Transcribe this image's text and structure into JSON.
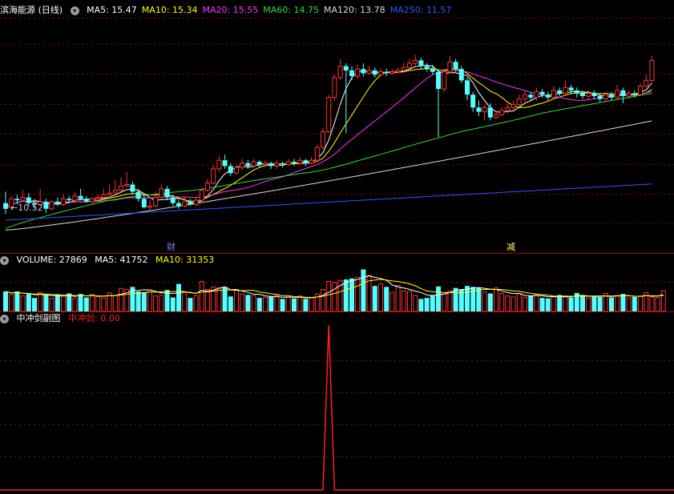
{
  "header": {
    "title": "滨海能源 (日线)",
    "ma_items": [
      {
        "label": "MA5: 15.47",
        "color": "#ffffff"
      },
      {
        "label": "MA10: 15.34",
        "color": "#ffff00"
      },
      {
        "label": "MA20: 15.55",
        "color": "#ff33ff"
      },
      {
        "label": "MA60: 14.75",
        "color": "#33dd33"
      },
      {
        "label": "MA120: 13.78",
        "color": "#d8d8d8"
      },
      {
        "label": "MA250: 11.57",
        "color": "#3355ff"
      }
    ]
  },
  "volume_header": {
    "label": "VOLUME: 27869",
    "ma5": "MA5: 41752",
    "ma10": "MA10: 31353"
  },
  "indicator_header": {
    "name": "中冲剑副图",
    "value": "中冲剑: 0.00"
  },
  "markers": {
    "cai": "财",
    "jian": "减"
  },
  "min_price_label": "10.52",
  "colors": {
    "up": "#ff3232",
    "down": "#54ffff",
    "grid": "#a00000",
    "ma5": "#ffffff",
    "ma10": "#ffff00",
    "ma20": "#ff33ff",
    "ma60": "#33dd33",
    "ma120": "#d8d8d8",
    "ma250": "#3355ff",
    "indicator": "#ff2020"
  },
  "chart_data": [
    {
      "type": "candlestick",
      "title": "滨海能源 (日线)",
      "price_range": [
        9.6,
        17.4
      ],
      "candles": [
        [
          10.9,
          10.7,
          11.3,
          10.52
        ],
        [
          10.75,
          11.05,
          11.15,
          10.65
        ],
        [
          11.05,
          11.0,
          11.2,
          10.85
        ],
        [
          11.0,
          11.1,
          11.35,
          10.95
        ],
        [
          11.1,
          10.9,
          11.25,
          10.8
        ],
        [
          10.9,
          10.85,
          11.05,
          10.7
        ],
        [
          10.85,
          10.95,
          11.4,
          10.8
        ],
        [
          10.95,
          10.7,
          11.05,
          10.55
        ],
        [
          10.7,
          10.95,
          11.0,
          10.65
        ],
        [
          10.95,
          10.85,
          11.1,
          10.8
        ],
        [
          10.85,
          11.05,
          11.2,
          10.8
        ],
        [
          11.05,
          11.0,
          11.15,
          10.9
        ],
        [
          11.0,
          11.15,
          11.3,
          10.95
        ],
        [
          11.15,
          11.05,
          11.4,
          11.0
        ],
        [
          11.05,
          10.95,
          11.15,
          10.9
        ],
        [
          10.95,
          11.05,
          11.1,
          10.85
        ],
        [
          11.05,
          11.1,
          11.2,
          11.0
        ],
        [
          11.1,
          11.2,
          11.4,
          11.05
        ],
        [
          11.2,
          11.25,
          11.55,
          11.15
        ],
        [
          11.25,
          11.35,
          11.7,
          11.2
        ],
        [
          11.35,
          11.5,
          11.8,
          11.3
        ],
        [
          11.5,
          11.55,
          12.0,
          11.45
        ],
        [
          11.55,
          11.3,
          11.65,
          11.2
        ],
        [
          11.3,
          11.05,
          11.4,
          10.95
        ],
        [
          11.05,
          10.75,
          11.2,
          10.7
        ],
        [
          10.75,
          10.8,
          11.0,
          10.65
        ],
        [
          10.8,
          11.1,
          11.3,
          10.75
        ],
        [
          11.1,
          11.4,
          11.55,
          11.05
        ],
        [
          11.4,
          11.1,
          11.5,
          11.0
        ],
        [
          11.1,
          10.9,
          11.2,
          10.8
        ],
        [
          10.9,
          10.8,
          11.0,
          10.7
        ],
        [
          10.8,
          10.95,
          11.1,
          10.75
        ],
        [
          10.95,
          10.85,
          11.05,
          10.8
        ],
        [
          10.85,
          11.0,
          11.1,
          10.8
        ],
        [
          11.0,
          11.35,
          11.45,
          10.95
        ],
        [
          11.35,
          11.6,
          11.75,
          11.3
        ],
        [
          11.6,
          12.1,
          12.25,
          11.55
        ],
        [
          12.1,
          12.4,
          12.55,
          12.0
        ],
        [
          12.4,
          12.2,
          12.6,
          12.1
        ],
        [
          12.2,
          11.95,
          12.3,
          11.85
        ],
        [
          11.95,
          12.15,
          12.25,
          11.9
        ],
        [
          12.15,
          12.3,
          12.45,
          12.05
        ],
        [
          12.3,
          12.2,
          12.4,
          12.1
        ],
        [
          12.2,
          12.35,
          12.45,
          12.15
        ],
        [
          12.35,
          12.25,
          12.4,
          12.15
        ],
        [
          12.25,
          12.3,
          12.4,
          12.15
        ],
        [
          12.3,
          12.2,
          12.35,
          12.1
        ],
        [
          12.2,
          12.3,
          12.4,
          12.1
        ],
        [
          12.3,
          12.25,
          12.35,
          12.15
        ],
        [
          12.25,
          12.35,
          12.45,
          12.2
        ],
        [
          12.35,
          12.3,
          12.45,
          12.2
        ],
        [
          12.3,
          12.4,
          12.5,
          12.25
        ],
        [
          12.4,
          12.3,
          12.45,
          12.2
        ],
        [
          12.3,
          12.4,
          12.5,
          12.25
        ],
        [
          12.4,
          12.85,
          12.95,
          12.35
        ],
        [
          12.85,
          13.4,
          13.55,
          12.8
        ],
        [
          13.4,
          14.6,
          14.7,
          13.35
        ],
        [
          14.6,
          15.3,
          15.4,
          14.5
        ],
        [
          15.3,
          15.7,
          15.95,
          15.2
        ],
        [
          15.7,
          15.55,
          15.8,
          13.35
        ],
        [
          15.55,
          15.35,
          15.7,
          15.2
        ],
        [
          15.35,
          15.6,
          15.75,
          15.25
        ],
        [
          15.6,
          15.45,
          15.8,
          15.35
        ],
        [
          15.45,
          15.55,
          15.7,
          15.4
        ],
        [
          15.55,
          15.4,
          15.65,
          15.3
        ],
        [
          15.4,
          15.5,
          15.6,
          15.35
        ],
        [
          15.5,
          15.45,
          15.6,
          15.35
        ],
        [
          15.45,
          15.5,
          15.6,
          15.4
        ],
        [
          15.5,
          15.55,
          15.65,
          15.45
        ],
        [
          15.55,
          15.65,
          15.8,
          15.5
        ],
        [
          15.65,
          15.8,
          15.95,
          15.6
        ],
        [
          15.8,
          15.9,
          16.1,
          15.7
        ],
        [
          15.9,
          15.7,
          16.0,
          15.6
        ],
        [
          15.7,
          15.6,
          15.8,
          15.5
        ],
        [
          15.6,
          15.5,
          15.75,
          15.4
        ],
        [
          15.5,
          14.9,
          15.6,
          13.2
        ],
        [
          14.9,
          15.5,
          15.6,
          14.8
        ],
        [
          15.5,
          15.85,
          16.05,
          15.45
        ],
        [
          15.85,
          15.6,
          15.95,
          15.5
        ],
        [
          15.6,
          15.2,
          15.7,
          15.1
        ],
        [
          15.2,
          14.7,
          15.3,
          14.5
        ],
        [
          14.7,
          14.25,
          14.8,
          14.1
        ],
        [
          14.25,
          14.1,
          14.5,
          13.95
        ],
        [
          14.1,
          14.25,
          14.35,
          13.8
        ],
        [
          14.25,
          13.9,
          14.4,
          13.8
        ],
        [
          13.9,
          14.0,
          14.15,
          13.85
        ],
        [
          14.0,
          14.15,
          14.25,
          13.95
        ],
        [
          14.15,
          14.25,
          14.4,
          14.05
        ],
        [
          14.25,
          14.35,
          14.5,
          14.15
        ],
        [
          14.35,
          14.55,
          14.7,
          14.3
        ],
        [
          14.55,
          14.7,
          14.85,
          14.45
        ],
        [
          14.7,
          14.6,
          14.8,
          14.5
        ],
        [
          14.6,
          14.8,
          14.95,
          14.5
        ],
        [
          14.8,
          14.7,
          14.9,
          14.6
        ],
        [
          14.7,
          14.6,
          14.8,
          14.5
        ],
        [
          14.6,
          14.85,
          15.0,
          14.55
        ],
        [
          14.85,
          14.75,
          14.95,
          14.65
        ],
        [
          14.75,
          14.95,
          15.2,
          14.7
        ],
        [
          14.95,
          14.85,
          15.05,
          14.75
        ],
        [
          14.85,
          14.75,
          14.95,
          14.6
        ],
        [
          14.75,
          14.65,
          14.85,
          14.55
        ],
        [
          14.65,
          14.75,
          14.85,
          14.55
        ],
        [
          14.75,
          14.65,
          14.85,
          14.55
        ],
        [
          14.65,
          14.55,
          14.75,
          14.45
        ],
        [
          14.55,
          14.7,
          14.8,
          14.45
        ],
        [
          14.7,
          14.6,
          14.8,
          14.5
        ],
        [
          14.6,
          14.85,
          15.05,
          14.55
        ],
        [
          14.85,
          14.65,
          14.95,
          14.4
        ],
        [
          14.65,
          14.75,
          14.85,
          14.55
        ],
        [
          14.75,
          14.7,
          14.85,
          14.6
        ],
        [
          14.7,
          15.0,
          15.1,
          14.65
        ],
        [
          15.0,
          15.2,
          15.4,
          14.95
        ],
        [
          15.2,
          15.9,
          16.05,
          15.15
        ]
      ]
    },
    {
      "type": "bar",
      "title": "VOLUME",
      "values": [
        40,
        34,
        40,
        31,
        35,
        27,
        38,
        33,
        26,
        33,
        30,
        36,
        26,
        35,
        28,
        34,
        30,
        27,
        37,
        32,
        46,
        44,
        49,
        40,
        38,
        43,
        31,
        32,
        43,
        28,
        55,
        38,
        27,
        32,
        60,
        44,
        49,
        47,
        48,
        30,
        44,
        35,
        33,
        32,
        27,
        28,
        30,
        32,
        25,
        29,
        26,
        31,
        25,
        27,
        35,
        44,
        60,
        58,
        62,
        64,
        66,
        68,
        84,
        72,
        51,
        55,
        49,
        38,
        52,
        41,
        40,
        32,
        25,
        27,
        33,
        50,
        38,
        41,
        47,
        44,
        51,
        49,
        48,
        39,
        36,
        47,
        36,
        31,
        29,
        36,
        28,
        32,
        34,
        27,
        26,
        29,
        33,
        31,
        28,
        37,
        32,
        27,
        30,
        29,
        36,
        28,
        32,
        35,
        27,
        29,
        30,
        38,
        29,
        28,
        41
      ]
    },
    {
      "type": "line",
      "title": "中冲剑副图",
      "series": [
        {
          "name": "中冲剑",
          "spike_index": 56,
          "spike_value": 1.0,
          "base_value": 0.0
        }
      ]
    }
  ]
}
